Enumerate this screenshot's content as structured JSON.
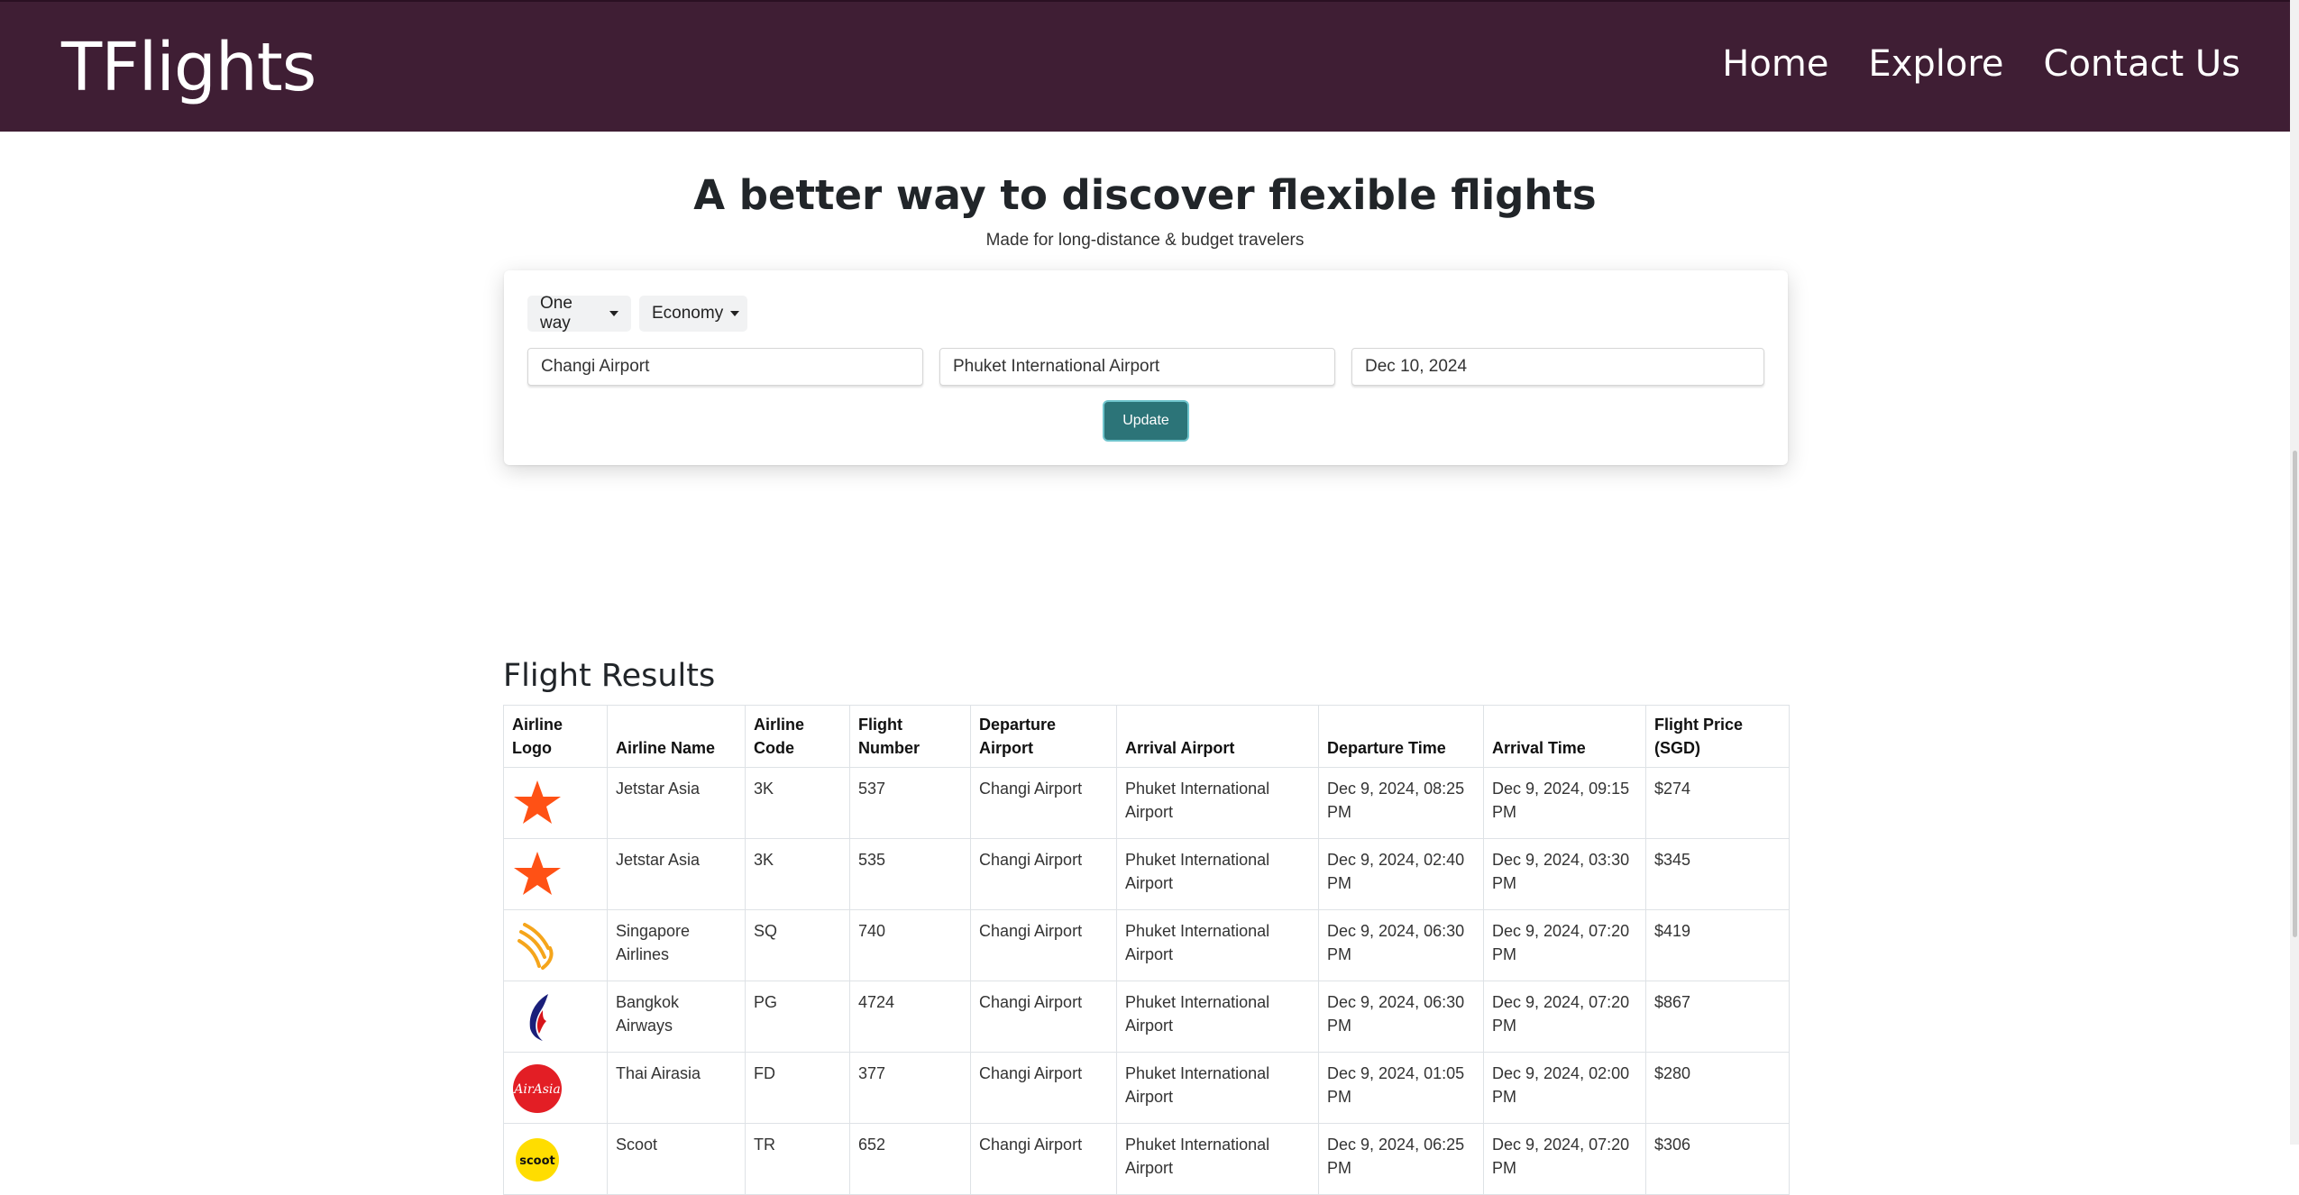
{
  "header": {
    "brand": "TFlights",
    "nav": [
      "Home",
      "Explore",
      "Contact Us"
    ]
  },
  "hero": {
    "title": "A better way to discover flexible flights",
    "subtitle": "Made for long-distance & budget travelers"
  },
  "search": {
    "trip_type": "One way",
    "cabin_class": "Economy",
    "origin": "Changi Airport",
    "destination": "Phuket International Airport",
    "date": "Dec 10, 2024",
    "update_label": "Update"
  },
  "results": {
    "title": "Flight Results",
    "columns": [
      "Airline Logo",
      "Airline Name",
      "Airline Code",
      "Flight Number",
      "Departure Airport",
      "Arrival Airport",
      "Departure Time",
      "Arrival Time",
      "Flight Price (SGD)"
    ],
    "rows": [
      {
        "logo": "jetstar-star",
        "name": "Jetstar Asia",
        "code": "3K",
        "number": "537",
        "dep": "Changi Airport",
        "arr": "Phuket International Airport",
        "dep_time": "Dec 9, 2024, 08:25 PM",
        "arr_time": "Dec 9, 2024, 09:15 PM",
        "price": "$274"
      },
      {
        "logo": "jetstar-star",
        "name": "Jetstar Asia",
        "code": "3K",
        "number": "535",
        "dep": "Changi Airport",
        "arr": "Phuket International Airport",
        "dep_time": "Dec 9, 2024, 02:40 PM",
        "arr_time": "Dec 9, 2024, 03:30 PM",
        "price": "$345"
      },
      {
        "logo": "singapore-bird",
        "name": "Singapore Airlines",
        "code": "SQ",
        "number": "740",
        "dep": "Changi Airport",
        "arr": "Phuket International Airport",
        "dep_time": "Dec 9, 2024, 06:30 PM",
        "arr_time": "Dec 9, 2024, 07:20 PM",
        "price": "$419"
      },
      {
        "logo": "bangkok-flame",
        "name": "Bangkok Airways",
        "code": "PG",
        "number": "4724",
        "dep": "Changi Airport",
        "arr": "Phuket International Airport",
        "dep_time": "Dec 9, 2024, 06:30 PM",
        "arr_time": "Dec 9, 2024, 07:20 PM",
        "price": "$867"
      },
      {
        "logo": "airasia-circle",
        "logo_text": "AirAsia",
        "name": "Thai Airasia",
        "code": "FD",
        "number": "377",
        "dep": "Changi Airport",
        "arr": "Phuket International Airport",
        "dep_time": "Dec 9, 2024, 01:05 PM",
        "arr_time": "Dec 9, 2024, 02:00 PM",
        "price": "$280"
      },
      {
        "logo": "scoot-circle",
        "logo_text": "scoot",
        "name": "Scoot",
        "code": "TR",
        "number": "652",
        "dep": "Changi Airport",
        "arr": "Phuket International Airport",
        "dep_time": "Dec 9, 2024, 06:25 PM",
        "arr_time": "Dec 9, 2024, 07:20 PM",
        "price": "$306"
      }
    ]
  },
  "colors": {
    "header_bg": "#3f1e34",
    "button_bg": "#2c7478",
    "jetstar": "#ff5115",
    "singapore": "#f5a51b",
    "bangkok_blue": "#1a1f7a",
    "bangkok_red": "#d7141a",
    "airasia": "#e31e25",
    "scoot": "#ffdd00"
  }
}
